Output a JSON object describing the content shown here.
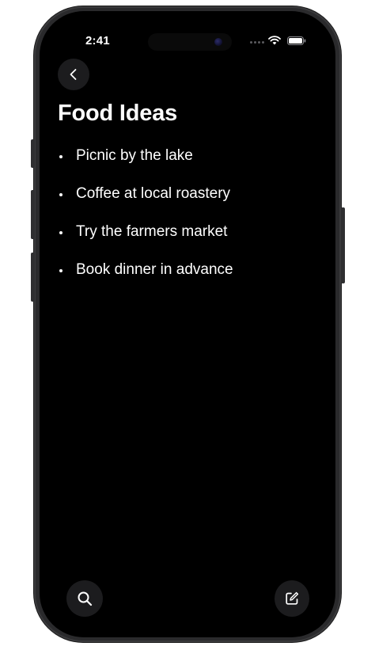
{
  "status_bar": {
    "time": "2:41"
  },
  "navigation": {
    "back_icon": "chevron-left-icon"
  },
  "note": {
    "title": "Food Ideas",
    "items": [
      "Picnic by the lake",
      "Coffee at local roastery",
      "Try the farmers market",
      "Book dinner in advance"
    ]
  },
  "toolbar": {
    "search_icon": "search-icon",
    "compose_icon": "compose-icon"
  },
  "colors": {
    "screen_background": "#000000",
    "text": "#ffffff",
    "button_background": "#1c1c1e",
    "device_frame": "#2a2a2c"
  }
}
